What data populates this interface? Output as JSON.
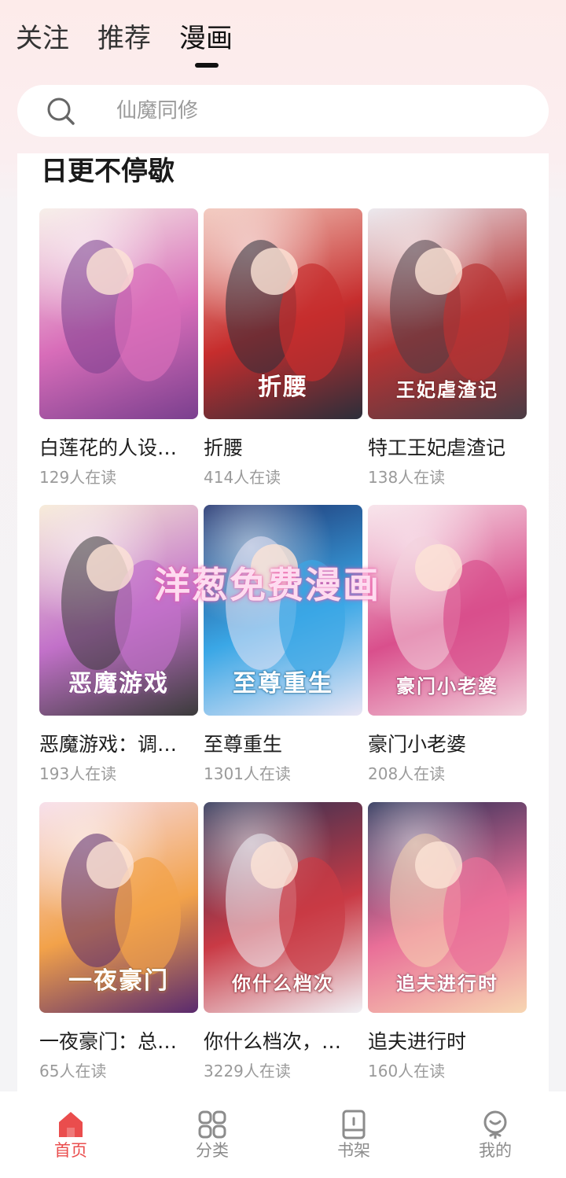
{
  "top_tabs": [
    {
      "label": "关注"
    },
    {
      "label": "推荐"
    },
    {
      "label": "漫画"
    }
  ],
  "active_tab": "漫画",
  "search": {
    "placeholder": "仙魔同修"
  },
  "section": {
    "title": "日更不停歇"
  },
  "comics": [
    {
      "title": "白莲花的人设…",
      "readers": "129人在读",
      "cover_text": "",
      "colors": [
        "#f6ede6",
        "#d86db9",
        "#7a3f8e"
      ]
    },
    {
      "title": "折腰",
      "readers": "414人在读",
      "cover_text": "折腰",
      "colors": [
        "#f1c4b8",
        "#c62d2d",
        "#2c2e3a"
      ]
    },
    {
      "title": "特工王妃虐渣记",
      "readers": "138人在读",
      "cover_text": "王妃虐渣记",
      "colors": [
        "#e9e6ec",
        "#b83333",
        "#4a3c45"
      ]
    },
    {
      "title": "恶魔游戏：调…",
      "readers": "193人在读",
      "cover_text": "恶魔游戏",
      "colors": [
        "#f6e9d4",
        "#c271c9",
        "#3b3b3b"
      ]
    },
    {
      "title": "至尊重生",
      "readers": "1301人在读",
      "cover_text": "至尊重生",
      "colors": [
        "#1d2e6b",
        "#3aa7e6",
        "#e9e6f5"
      ]
    },
    {
      "title": "豪门小老婆",
      "readers": "208人在读",
      "cover_text": "豪门小老婆",
      "colors": [
        "#f7e2e9",
        "#d94f8c",
        "#f2d1dc"
      ]
    },
    {
      "title": "一夜豪门：总…",
      "readers": "65人在读",
      "cover_text": "一夜豪门",
      "colors": [
        "#f6dbe8",
        "#f2a24a",
        "#5a2a6e"
      ]
    },
    {
      "title": "你什么档次，…",
      "readers": "3229人在读",
      "cover_text": "你什么档次",
      "colors": [
        "#2a3154",
        "#c93a45",
        "#f1f1f5"
      ]
    },
    {
      "title": "追夫进行时",
      "readers": "160人在读",
      "cover_text": "追夫进行时",
      "colors": [
        "#232a52",
        "#e96f98",
        "#f7d6b2"
      ]
    }
  ],
  "watermark": "洋葱免费漫画",
  "bottom_nav": [
    {
      "label": "首页",
      "icon": "home-icon"
    },
    {
      "label": "分类",
      "icon": "category-icon"
    },
    {
      "label": "书架",
      "icon": "bookshelf-icon"
    },
    {
      "label": "我的",
      "icon": "profile-icon"
    }
  ],
  "active_nav": "首页",
  "accent_color": "#ea4d4d"
}
